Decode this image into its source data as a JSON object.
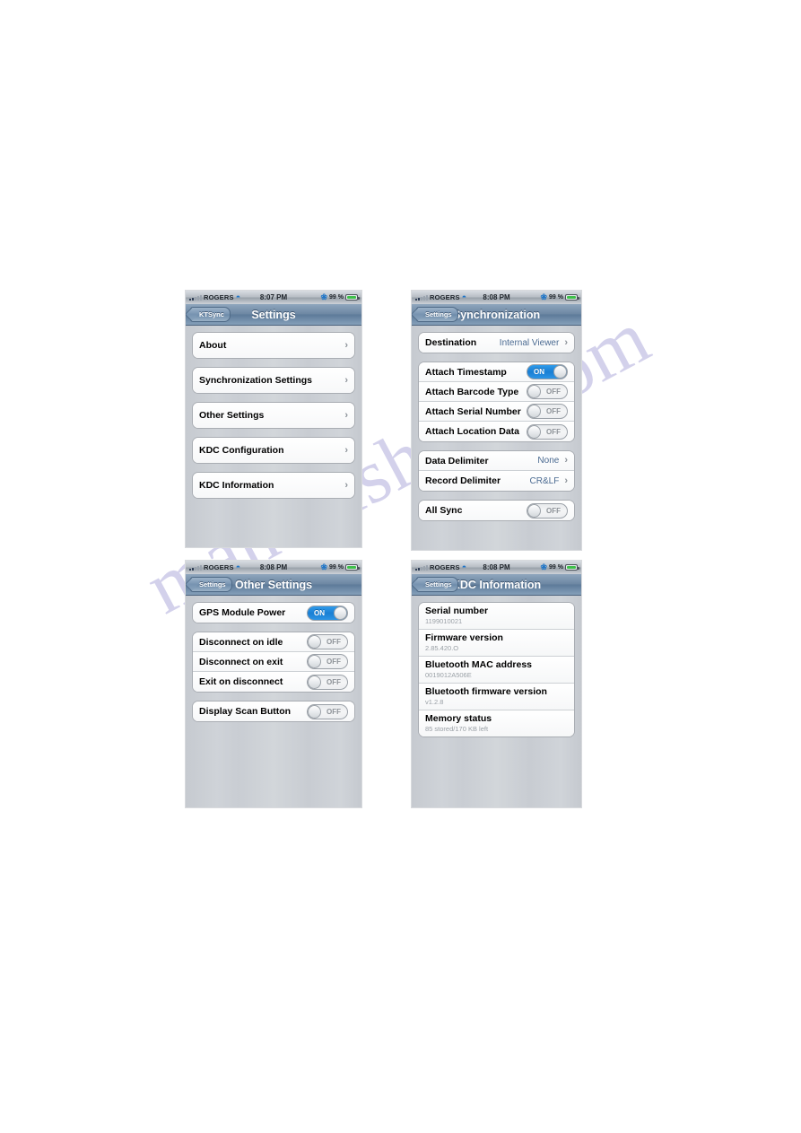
{
  "page": {
    "watermark": "manualshive.com",
    "watermark_color": "#b9b6e0",
    "background": "#ffffff"
  },
  "icons": {
    "wifi": "wifi-icon",
    "bluetooth": "bluetooth-icon",
    "battery": "battery-icon",
    "signal": "signal-bars-icon",
    "chevron": "chevron-right-icon"
  },
  "screenshots": [
    {
      "id": "settings",
      "status": {
        "carrier": "ROGERS",
        "time": "8:07 PM",
        "battery_text": "99 %",
        "battery_level": 99
      },
      "nav": {
        "back": "KTSync",
        "title": "Settings"
      },
      "groups": [
        {
          "rows": [
            {
              "type": "link",
              "label": "About",
              "chevron": "›"
            }
          ]
        },
        {
          "rows": [
            {
              "type": "link",
              "label": "Synchronization Settings",
              "chevron": "›"
            }
          ]
        },
        {
          "rows": [
            {
              "type": "link",
              "label": "Other Settings",
              "chevron": "›"
            }
          ]
        },
        {
          "rows": [
            {
              "type": "link",
              "label": "KDC Configuration",
              "chevron": "›"
            }
          ]
        },
        {
          "rows": [
            {
              "type": "link",
              "label": "KDC Information",
              "chevron": "›"
            }
          ]
        }
      ]
    },
    {
      "id": "sync",
      "status": {
        "carrier": "ROGERS",
        "time": "8:08 PM",
        "battery_text": "99 %",
        "battery_level": 99
      },
      "nav": {
        "back": "Settings",
        "title": "Synchronization"
      },
      "groups": [
        {
          "rows": [
            {
              "type": "value",
              "label": "Destination",
              "value": "Internal Viewer",
              "chevron": "›"
            }
          ]
        },
        {
          "rows": [
            {
              "type": "switch",
              "label": "Attach Timestamp",
              "state": "ON"
            },
            {
              "type": "switch",
              "label": "Attach Barcode Type",
              "state": "OFF"
            },
            {
              "type": "switch",
              "label": "Attach Serial Number",
              "state": "OFF"
            },
            {
              "type": "switch",
              "label": "Attach Location Data",
              "state": "OFF"
            }
          ]
        },
        {
          "rows": [
            {
              "type": "value",
              "label": "Data Delimiter",
              "value": "None",
              "chevron": "›"
            },
            {
              "type": "value",
              "label": "Record Delimiter",
              "value": "CR&LF",
              "chevron": "›"
            }
          ]
        },
        {
          "rows": [
            {
              "type": "switch",
              "label": "All Sync",
              "state": "OFF"
            }
          ]
        }
      ]
    },
    {
      "id": "other",
      "status": {
        "carrier": "ROGERS",
        "time": "8:08 PM",
        "battery_text": "99 %",
        "battery_level": 99
      },
      "nav": {
        "back": "Settings",
        "title": "Other Settings"
      },
      "groups": [
        {
          "rows": [
            {
              "type": "switch",
              "label": "GPS Module Power",
              "state": "ON"
            }
          ]
        },
        {
          "rows": [
            {
              "type": "switch",
              "label": "Disconnect on idle",
              "state": "OFF"
            },
            {
              "type": "switch",
              "label": "Disconnect on exit",
              "state": "OFF"
            },
            {
              "type": "switch",
              "label": "Exit on disconnect",
              "state": "OFF"
            }
          ]
        },
        {
          "rows": [
            {
              "type": "switch",
              "label": "Display Scan Button",
              "state": "OFF"
            }
          ]
        }
      ]
    },
    {
      "id": "kdcinfo",
      "status": {
        "carrier": "ROGERS",
        "time": "8:08 PM",
        "battery_text": "99 %",
        "battery_level": 99
      },
      "nav": {
        "back": "Settings",
        "title": "KDC Information"
      },
      "info": [
        {
          "title": "Serial number",
          "value": "1199010021"
        },
        {
          "title": "Firmware version",
          "value": "2.85.420.O"
        },
        {
          "title": "Bluetooth MAC address",
          "value": "0019012A506E"
        },
        {
          "title": "Bluetooth firmware version",
          "value": "v1.2.8"
        },
        {
          "title": "Memory status",
          "value": "85 stored/170 KB left"
        }
      ]
    }
  ]
}
